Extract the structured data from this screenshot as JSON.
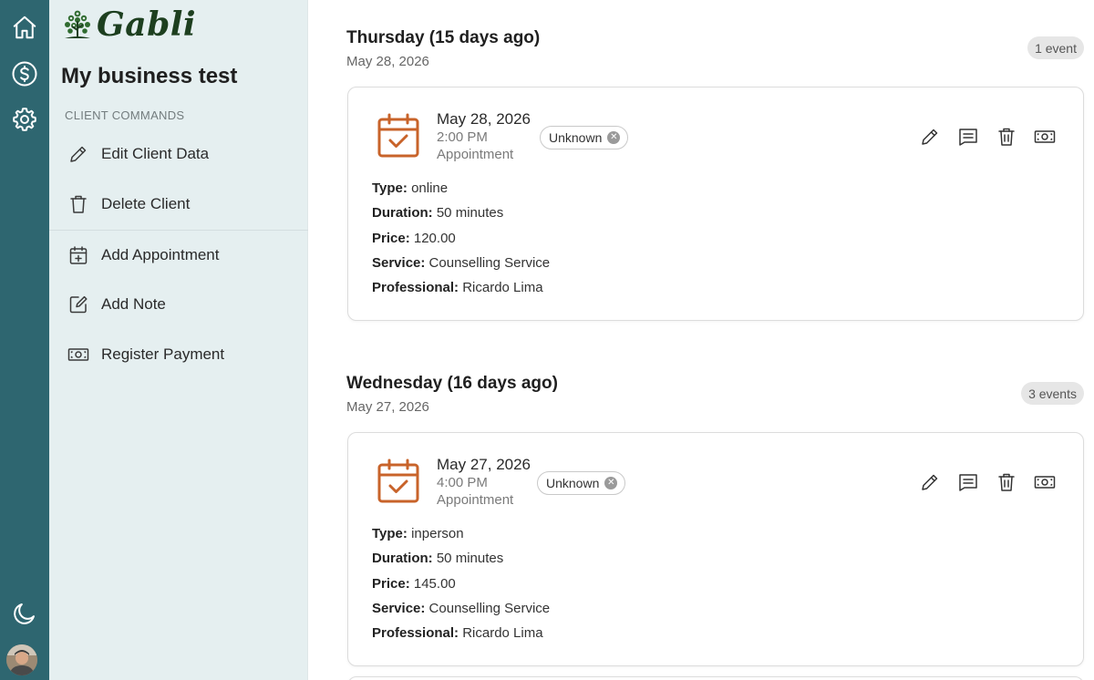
{
  "app": {
    "logo_text": "Gabli",
    "business_name": "My business test"
  },
  "rail": {
    "icons": [
      "home-icon",
      "dollar-icon",
      "gear-icon",
      "moon-icon"
    ]
  },
  "sidebar": {
    "section_label": "CLIENT COMMANDS",
    "commands": [
      {
        "label": "Edit Client Data",
        "icon": "pencil-icon"
      },
      {
        "label": "Delete Client",
        "icon": "trash-icon"
      },
      {
        "label": "Add Appointment",
        "icon": "calendar-plus-icon"
      },
      {
        "label": "Add Note",
        "icon": "note-edit-icon"
      },
      {
        "label": "Register Payment",
        "icon": "cash-icon"
      }
    ]
  },
  "colors": {
    "rail": "#2e6670",
    "sidebar": "#e5eff0",
    "calendar_accent": "#c8632a"
  },
  "labels": {
    "type": "Type:",
    "duration": "Duration:",
    "price": "Price:",
    "service": "Service:",
    "professional": "Professional:"
  },
  "days": [
    {
      "title": "Thursday (15 days ago)",
      "date": "May 28, 2026",
      "count": "1 event",
      "event": {
        "date": "May 28, 2026",
        "time": "2:00 PM",
        "kind": "Appointment",
        "status": "Unknown",
        "type": "online",
        "duration": "50 minutes",
        "price": "120.00",
        "service": "Counselling Service",
        "professional": "Ricardo Lima"
      }
    },
    {
      "title": "Wednesday (16 days ago)",
      "date": "May 27, 2026",
      "count": "3 events",
      "event": {
        "date": "May 27, 2026",
        "time": "4:00 PM",
        "kind": "Appointment",
        "status": "Unknown",
        "type": "inperson",
        "duration": "50 minutes",
        "price": "145.00",
        "service": "Counselling Service",
        "professional": "Ricardo Lima"
      }
    }
  ]
}
